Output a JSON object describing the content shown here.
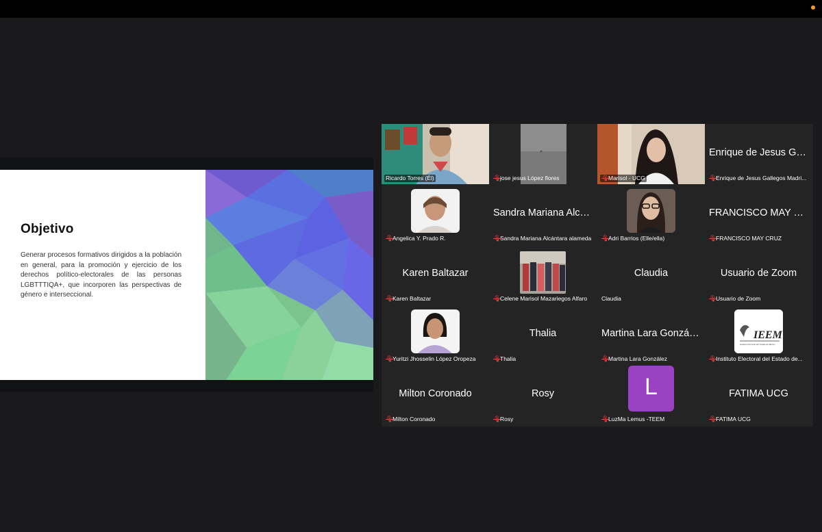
{
  "slide": {
    "title": "Objetivo",
    "body": "Generar procesos formativos dirigidos a la población en general, para la promoción y ejercicio de los derechos político-electorales de las personas LGBTTTIQA+, que incorporen las perspectivas de género e interseccional."
  },
  "participants": [
    {
      "label": "Ricardo Torres (Él)",
      "big": "",
      "mic": false,
      "video": true,
      "active": true
    },
    {
      "label": "jose jesus López flores",
      "big": "",
      "mic": true,
      "video": true
    },
    {
      "label": "Marisol - UCG",
      "big": "",
      "mic": true,
      "video": true
    },
    {
      "label": "Enrique de Jesus Gallegos Madri...",
      "big": "Enrique de Jesus Ga...",
      "mic": true
    },
    {
      "label": "Angelica Y. Prado R.",
      "big": "",
      "mic": true,
      "video": true
    },
    {
      "label": "Sandra Mariana Alcántara alameda",
      "big": "Sandra Mariana Alcá...",
      "mic": true
    },
    {
      "label": "Adri Barrios (Elle/ella)",
      "big": "",
      "mic": true,
      "video": true
    },
    {
      "label": "FRANCISCO MAY CRUZ",
      "big": "FRANCISCO MAY C...",
      "mic": true
    },
    {
      "label": "Karen Baltazar",
      "big": "Karen Baltazar",
      "mic": true
    },
    {
      "label": "Celene Marisol Mazariegos Alfaro",
      "big": "",
      "mic": true,
      "video": true
    },
    {
      "label": "Claudia",
      "big": "Claudia",
      "mic": false
    },
    {
      "label": "Usuario de Zoom",
      "big": "Usuario de Zoom",
      "mic": true
    },
    {
      "label": "Yuritzi Jhosselin López Oropeza",
      "big": "",
      "mic": true,
      "video": true
    },
    {
      "label": "Thalia",
      "big": "Thalia",
      "mic": true
    },
    {
      "label": "Martina Lara González",
      "big": "Martina Lara González",
      "mic": true
    },
    {
      "label": "Instituto Electoral del Estado de...",
      "big": "",
      "mic": true,
      "video": true,
      "logo_text": "IEEM",
      "logo_sub": "Instituto Electoral del Estado de México"
    },
    {
      "label": "Milton Coronado",
      "big": "Milton Coronado",
      "mic": true
    },
    {
      "label": "Rosy",
      "big": "Rosy",
      "mic": true
    },
    {
      "label": "LuzMa Lemus -TEEM",
      "big": "",
      "mic": true,
      "avatar": "L"
    },
    {
      "label": "FATIMA UCG",
      "big": "FATIMA UCG",
      "mic": true
    }
  ],
  "colors": {
    "active_speaker": "#7bd36b",
    "avatar": "#9a43c2",
    "muted_icon": "#e4453a"
  }
}
